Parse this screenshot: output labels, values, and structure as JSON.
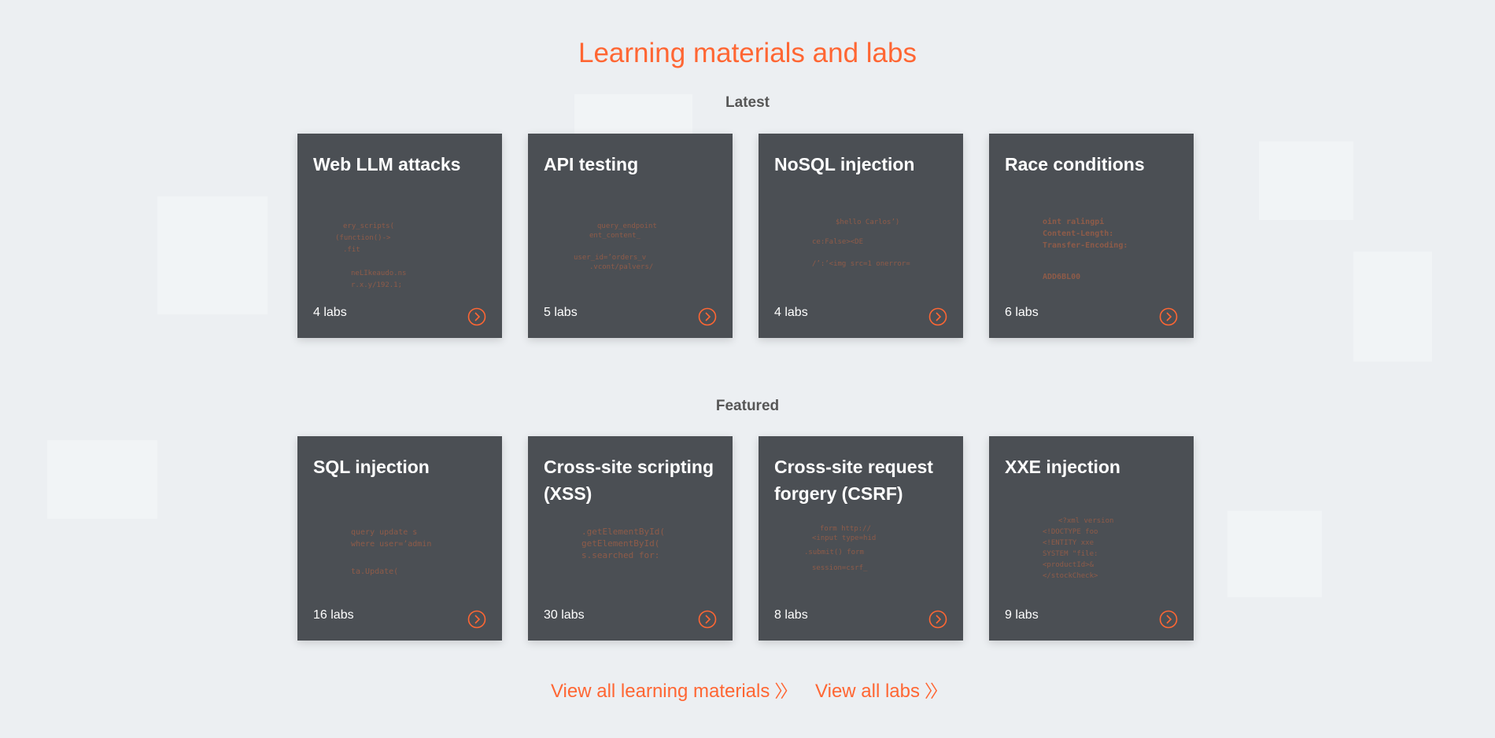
{
  "page": {
    "title": "Learning materials and labs"
  },
  "sections": [
    {
      "label": "Latest",
      "cards": [
        {
          "title": "Web LLM attacks",
          "count": "4 labs"
        },
        {
          "title": "API testing",
          "count": "5 labs"
        },
        {
          "title": "NoSQL injection",
          "count": "4 labs"
        },
        {
          "title": "Race conditions",
          "count": "6 labs"
        }
      ]
    },
    {
      "label": "Featured",
      "cards": [
        {
          "title": "SQL injection",
          "count": "16 labs"
        },
        {
          "title": "Cross-site scripting (XSS)",
          "count": "30 labs"
        },
        {
          "title": "Cross-site request forgery (CSRF)",
          "count": "8 labs"
        },
        {
          "title": "XXE injection",
          "count": "9 labs"
        }
      ]
    }
  ],
  "links": {
    "learning_materials": "View all learning materials",
    "labs": "View all labs"
  },
  "icons": {
    "card_arrow": "chevron-right-circle-icon",
    "link_chevron": "double-chevron-right-icon"
  },
  "colors": {
    "accent": "#ff6633",
    "card_bg": "#4b4f54",
    "page_bg": "#eceff2"
  }
}
